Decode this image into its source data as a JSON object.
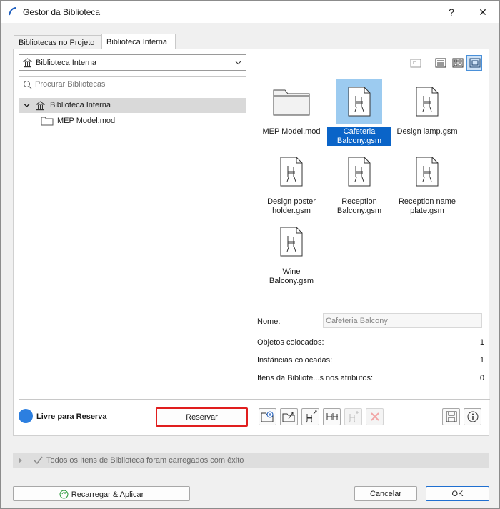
{
  "window": {
    "title": "Gestor da Biblioteca",
    "help": "?",
    "close": "✕"
  },
  "tabs": [
    {
      "label": "Bibliotecas no Projeto",
      "active": false
    },
    {
      "label": "Biblioteca Interna",
      "active": true
    }
  ],
  "left": {
    "dropdown_value": "Biblioteca Interna",
    "search_placeholder": "Procurar Bibliotecas",
    "tree": [
      {
        "label": "Biblioteca Interna",
        "selected": true,
        "expanded": true
      },
      {
        "label": "MEP Model.mod",
        "selected": false
      }
    ]
  },
  "items": [
    {
      "label": "MEP Model.mod",
      "type": "folder",
      "selected": false
    },
    {
      "label": "Cafeteria Balcony.gsm",
      "type": "object",
      "selected": true
    },
    {
      "label": "Design lamp.gsm",
      "type": "object",
      "selected": false
    },
    {
      "label": "Design poster holder.gsm",
      "type": "object",
      "selected": false
    },
    {
      "label": "Reception Balcony.gsm",
      "type": "object",
      "selected": false
    },
    {
      "label": "Reception name plate.gsm",
      "type": "object",
      "selected": false
    },
    {
      "label": "Wine Balcony.gsm",
      "type": "object",
      "selected": false
    }
  ],
  "properties": {
    "name_label": "Nome:",
    "name_value": "Cafeteria Balcony",
    "rows": [
      {
        "label": "Objetos colocados:",
        "value": "1"
      },
      {
        "label": "Instâncias colocadas:",
        "value": "1"
      },
      {
        "label": "Itens da Bibliote...s nos atributos:",
        "value": "0"
      }
    ]
  },
  "status": {
    "label": "Livre para Reserva",
    "color": "#2c7fe0"
  },
  "reserve_button": "Reservar",
  "message": "Todos os Itens de Biblioteca foram carregados com êxito",
  "footer": {
    "reload": "Recarregar & Aplicar",
    "cancel": "Cancelar",
    "ok": "OK"
  },
  "colors": {
    "accent": "#0a64c8",
    "reserve_border": "#e01e1e"
  }
}
